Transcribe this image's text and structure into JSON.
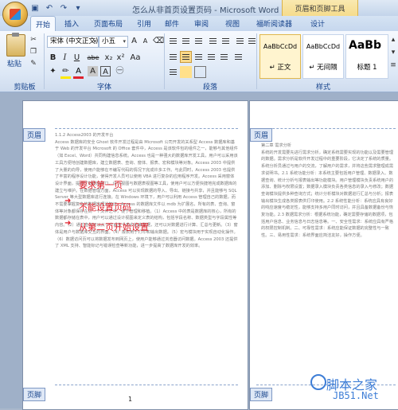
{
  "window": {
    "title": "怎么从非首页设置页码 - Microsoft Word"
  },
  "quick_access": {
    "items": [
      "save-icon",
      "undo-icon",
      "redo-icon",
      "customize-icon"
    ]
  },
  "contextual": {
    "group_title": "页眉和页脚工具",
    "tab": "设计"
  },
  "tabs": [
    "开始",
    "插入",
    "页面布局",
    "引用",
    "邮件",
    "审阅",
    "视图",
    "福昕阅读器"
  ],
  "ribbon": {
    "clipboard": {
      "paste_label": "粘贴",
      "group_label": "剪贴板"
    },
    "font": {
      "name": "宋体 (中文正文)",
      "size": "小五",
      "group_label": "字体",
      "buttons": [
        "B",
        "I",
        "U",
        "abe",
        "x₂",
        "x²",
        "Aa",
        "A",
        "A",
        "A"
      ]
    },
    "paragraph": {
      "group_label": "段落"
    },
    "styles": {
      "group_label": "样式",
      "items": [
        {
          "sample": "AaBbCcDd",
          "name": "↵ 正文"
        },
        {
          "sample": "AaBbCcDd",
          "name": "↵ 无间隔"
        },
        {
          "sample": "AaBb",
          "name": "标题 1"
        }
      ]
    }
  },
  "document": {
    "header_tag": "页眉",
    "footer_tag": "页脚",
    "page_number": "1",
    "annotations": [
      "要求第一页",
      "不能设置页码",
      "从第二页开始设置"
    ],
    "page1_heading": "1.1.2 Access2003 的开发平台",
    "page1_text": "Access 数据库的安全 Ghost 软件开发过程是由 Microsoft 公司开发的关系型 Access 数据库和基于 Web 的开发平台 Microsoft 的 Office 套件中，Access 是该软件包的组件之一，能够与其他组件（如 Excel、Word）共同构建信息系统。Access 也是一种强大的数据库开发工具，用户可以采用该工具方便地创建数据库，建立数据表、查询、窗体、报表、宏和模块等对象。Access 2003 中提供了大量的向导，使用户能够在不编写代码的情况下完成许多工作。与此同时，Access 2003 也提供了丰富的程序设计功能，使得开发人员可以使用 VBA 进行复杂的应用程序开发。Access 采用窗体设计界面，提供了数据库窗口、设计视图与数据表视图等工具，使用户可以方便快捷地完成数据库的建立与维护。在数据管理方面，Access 可以实现数据的导入、导出、链接与共享，并且能够与 SQL Server 等大型数据库进行连接。在 Windows 环境下，用户可以利用 Access 管理自己的数据，而不需要掌握复杂的数据库理论知识。Access 的数据库文件以 mdb 为扩展名，所有的表、查询、窗体等对象都保存在同一个文件之中，便于管理和移植。（1）Access 中的表是数据库的核心，所有的数据都存储在表中，用户可以通过设计视图来定义表的结构，包括字段名称、数据类型与字段属性等内容。（2）通过查询可以从一个或多个表中检索数据，还可以对数据进行计算、汇总与更新。（3）窗体是用户与数据库交互的界面。（4）报表用于打印和输出数据。（5）宏与模块用于实现自动化操作。（6）数据访问页可以将数据发布到网页上，使用户能够通过浏览器访问数据。Access 2003 还提供了 XML 支持、智能标记与错误检查等新功能，进一步提高了数据库开发的效率。",
    "page2_heading": "第二章 需求分析",
    "page2_text": "系统的开发需要先进行需求分析，确定系统需要实现的功能以及需要管理的数据。需求分析是软件开发过程中的重要阶段，它决定了系统的质量。系统分析员通过与用户的交流，了解用户的需求，并将这些需求整理成需求说明书。2.1 系统功能分析：本系统主要包括用户管理、数据录入、数据查询、统计分析与报表输出等功能模块。用户管理模块负责系统用户的添加、删除与权限设置；数据录入模块负责各类信息的录入与修改；数据查询模块提供多种查询方式；统计分析模块对数据进行汇总与分析；报表输出模块生成各类报表供打印使用。2.2 系统性能分析：系统应具有良好的响应速度与稳定性，能够支持多用户同时访问，并且具备数据备份与恢复功能。2.3 数据需求分析：根据系统功能，确定需要存储的数据项，包括用户信息、业务信息与日志信息等。一、安全性需求：系统应具有严格的权限控制机制。二、可靠性需求：系统应能保证数据的完整性与一致性。三、易用性需求：系统界面应简洁友好，操作方便。"
  },
  "watermark": {
    "line1": "脚本之家",
    "line2": "JB51.Net"
  }
}
